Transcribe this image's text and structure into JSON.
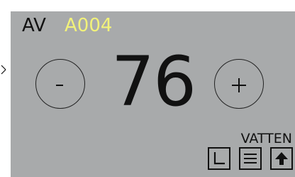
{
  "header": {
    "mode": "AV",
    "code": "A004"
  },
  "control": {
    "value": "76",
    "decrease_label": "-",
    "increase_label": "+"
  },
  "status": {
    "label": "VATTEN"
  },
  "toolbar": {
    "buttons": [
      {
        "icon": "corner-bracket-icon"
      },
      {
        "icon": "menu-lines-icon"
      },
      {
        "icon": "arrow-up-icon"
      }
    ]
  },
  "colors": {
    "panel_background": "#a8aaab",
    "code_text": "#f2f27a",
    "foreground": "#111111"
  }
}
